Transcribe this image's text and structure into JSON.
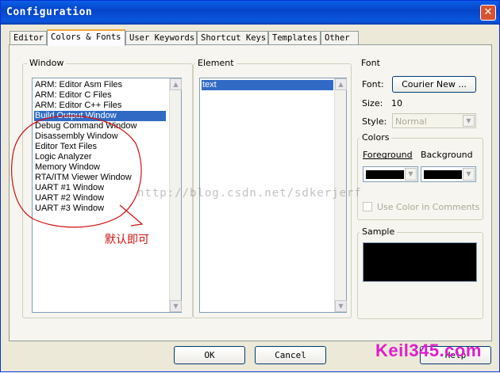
{
  "window": {
    "title": "Configuration",
    "close_glyph": "✕"
  },
  "tabs": [
    {
      "label": "Editor"
    },
    {
      "label": "Colors & Fonts",
      "active": true
    },
    {
      "label": "User Keywords"
    },
    {
      "label": "Shortcut Keys"
    },
    {
      "label": "Templates"
    },
    {
      "label": "Other"
    }
  ],
  "window_group": {
    "legend": "Window",
    "items": [
      "ARM: Editor Asm Files",
      "ARM: Editor C Files",
      "ARM: Editor C++ Files",
      "Build Output Window",
      "Debug Command Window",
      "Disassembly Window",
      "Editor Text Files",
      "Logic Analyzer",
      "Memory Window",
      "RTA/ITM Viewer Window",
      "UART #1 Window",
      "UART #2 Window",
      "UART #3 Window"
    ],
    "selected_index": 3
  },
  "element_group": {
    "legend": "Element",
    "items": [
      "text"
    ],
    "selected_index": 0
  },
  "font_group": {
    "legend": "Font",
    "font_label": "Font:",
    "font_button": "Courier New ...",
    "size_label": "Size:",
    "size_value": "10",
    "style_label": "Style:",
    "style_value": "Normal"
  },
  "colors_group": {
    "legend": "Colors",
    "foreground_label": "Foreground",
    "background_label": "Background",
    "foreground_color": "#000000",
    "background_color": "#000000",
    "use_color_label": "Use Color in Comments"
  },
  "sample_group": {
    "legend": "Sample",
    "sample_color": "#000000"
  },
  "footer": {
    "ok": "OK",
    "cancel": "Cancel",
    "help": "Help"
  },
  "overlay": {
    "watermark": "http://blog.csdn.net/sdkerjerf",
    "annotation": "默认即可",
    "annotation_color": "#d01010",
    "logo": "Keil345.com",
    "logo_color": "#e01ecb"
  }
}
